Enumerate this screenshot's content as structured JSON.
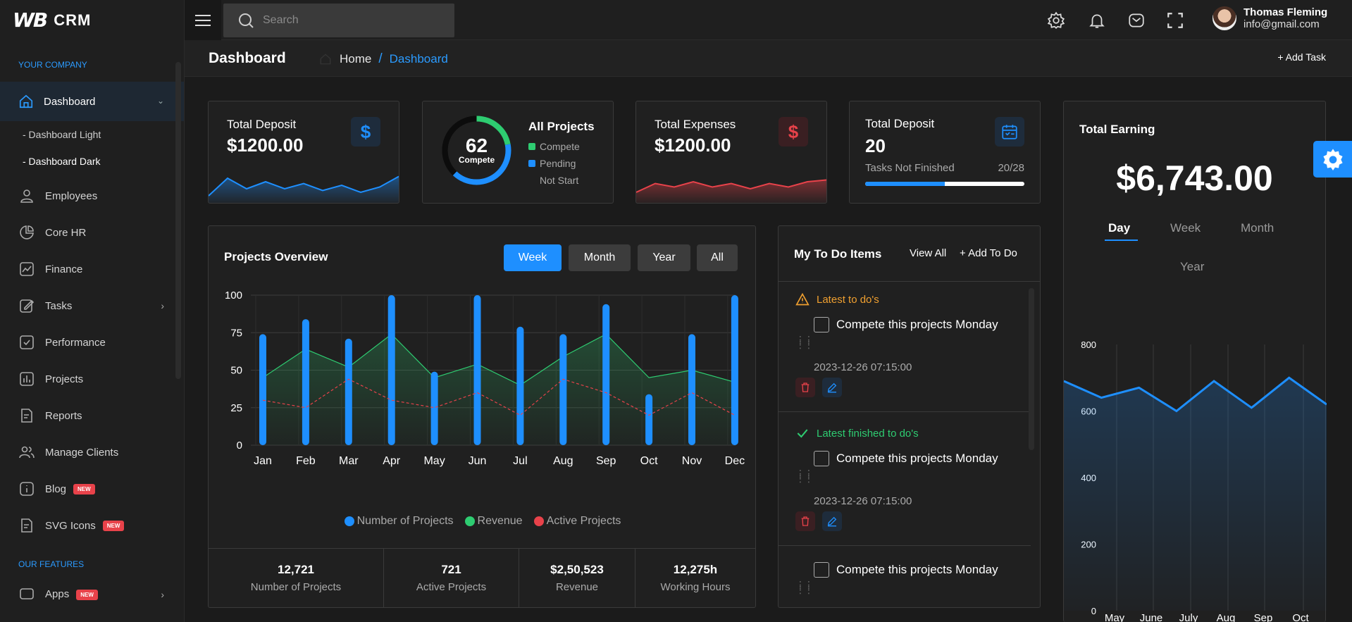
{
  "brand": {
    "logo": "WB",
    "name": "CRM"
  },
  "sidebar": {
    "section_company": "YOUR COMPANY",
    "active": {
      "label": "Dashboard"
    },
    "subs": [
      "- Dashboard Light",
      "- Dashboard Dark"
    ],
    "items": [
      {
        "label": "Employees",
        "icon": "user-icon"
      },
      {
        "label": "Core HR",
        "icon": "pie-icon"
      },
      {
        "label": "Finance",
        "icon": "finance-icon"
      },
      {
        "label": "Tasks",
        "icon": "edit-icon"
      },
      {
        "label": "Performance",
        "icon": "check-square-icon"
      },
      {
        "label": "Projects",
        "icon": "bar-chart-icon"
      },
      {
        "label": "Reports",
        "icon": "file-icon"
      },
      {
        "label": "Manage Clients",
        "icon": "users-icon"
      },
      {
        "label": "Blog",
        "icon": "info-icon",
        "badge": "NEW"
      },
      {
        "label": "SVG Icons",
        "icon": "file-icon",
        "badge": "NEW"
      }
    ],
    "section_features": "OUR FEATURES",
    "apps": {
      "label": "Apps",
      "badge": "NEW"
    }
  },
  "topbar": {
    "search_placeholder": "Search",
    "user_name": "Thomas Fleming",
    "user_email": "info@gmail.com"
  },
  "page": {
    "title": "Dashboard",
    "breadcrumb_home": "Home",
    "breadcrumb_sep": "/",
    "breadcrumb_current": "Dashboard",
    "add_task": "+ Add Task"
  },
  "cards": {
    "deposit": {
      "title": "Total Deposit",
      "value": "$1200.00",
      "badge": "$"
    },
    "projects": {
      "value": "62",
      "label": "Compete",
      "title": "All Projects",
      "legend": [
        "Compete",
        "Pending",
        "Not Start"
      ]
    },
    "expenses": {
      "title": "Total Expenses",
      "value": "$1200.00",
      "badge": "$"
    },
    "tasks": {
      "title": "Total Deposit",
      "value": "20",
      "sub": "Tasks Not Finished",
      "ratio": "20/28",
      "progress": 0.5
    }
  },
  "overview": {
    "title": "Projects Overview",
    "tabs": [
      "Week",
      "Month",
      "Year",
      "All"
    ],
    "active_tab": "Week",
    "footer": [
      {
        "value": "12,721",
        "label": "Number of Projects"
      },
      {
        "value": "721",
        "label": "Active Projects"
      },
      {
        "value": "$2,50,523",
        "label": "Revenue"
      },
      {
        "value": "12,275h",
        "label": "Working Hours"
      }
    ]
  },
  "todo": {
    "title": "My To Do Items",
    "view_all": "View All",
    "add": "+ Add To Do",
    "latest_label": "Latest to do's",
    "finished_label": "Latest finished to do's",
    "items": [
      {
        "text": "Compete this projects Monday",
        "time": "2023-12-26 07:15:00"
      },
      {
        "text": "Compete this projects Monday",
        "time": "2023-12-26 07:15:00"
      },
      {
        "text": "Compete this projects Monday"
      }
    ]
  },
  "earning": {
    "title": "Total Earning",
    "value": "$6,743.00",
    "tabs": [
      "Day",
      "Week",
      "Month",
      "Year"
    ],
    "active_tab": "Day"
  },
  "colors": {
    "accent": "#1e8fff",
    "green": "#2ecc71",
    "red": "#e8424a",
    "orange": "#f0a030"
  },
  "chart_data": [
    {
      "type": "bar",
      "categories": [
        "Jan",
        "Feb",
        "Mar",
        "Apr",
        "May",
        "Jun",
        "Jul",
        "Aug",
        "Sep",
        "Oct",
        "Nov",
        "Dec"
      ],
      "series": [
        {
          "name": "Number of Projects",
          "type": "bar",
          "values": [
            74,
            84,
            71,
            100,
            49,
            100,
            79,
            74,
            94,
            34,
            74,
            100
          ]
        },
        {
          "name": "Revenue",
          "type": "area",
          "values": [
            45,
            64,
            52,
            74,
            45,
            54,
            40,
            59,
            74,
            45,
            50,
            42
          ]
        },
        {
          "name": "Active Projects",
          "type": "line-dashed",
          "values": [
            30,
            25,
            44,
            30,
            25,
            35,
            20,
            44,
            35,
            20,
            35,
            20
          ]
        }
      ],
      "yticks": [
        0,
        25,
        50,
        75,
        100
      ],
      "ylim": [
        0,
        100
      ],
      "grid": true,
      "legend": "bottom"
    },
    {
      "type": "area",
      "categories": [
        "May",
        "June",
        "July",
        "Aug",
        "Sep",
        "Oct"
      ],
      "series": [
        {
          "values": [
            690,
            640,
            670,
            600,
            690,
            610,
            700,
            620
          ]
        }
      ],
      "yticks": [
        0,
        200,
        400,
        600,
        800
      ],
      "ylim": [
        0,
        800
      ],
      "grid": true
    },
    {
      "type": "area",
      "series": [
        {
          "values": [
            20,
            70,
            40,
            60,
            40,
            55,
            35,
            50,
            30,
            45,
            75
          ]
        }
      ]
    },
    {
      "type": "area",
      "series": [
        {
          "values": [
            30,
            55,
            45,
            60,
            45,
            55,
            40,
            55,
            45,
            60,
            65
          ]
        }
      ]
    },
    {
      "type": "pie",
      "categories": [
        "Compete",
        "Pending",
        "Not Start"
      ],
      "values": [
        22,
        40,
        38
      ]
    }
  ]
}
